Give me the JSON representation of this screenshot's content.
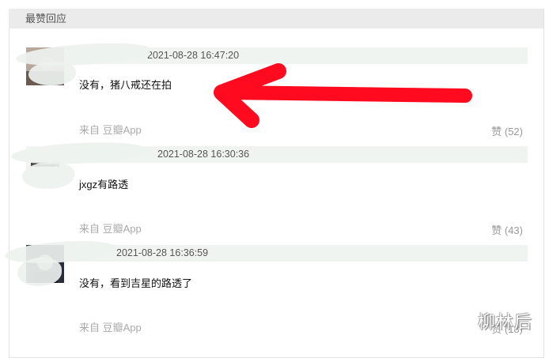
{
  "section": {
    "title": "最赞回应"
  },
  "comments": [
    {
      "time": "2021-08-28 16:47:20",
      "text": "没有，猪八戒还在拍",
      "source": "来自 豆瓣App",
      "likes": "赞 (52)"
    },
    {
      "time": "2021-08-28 16:30:36",
      "text": "jxgz有路透",
      "source": "来自 豆瓣App",
      "likes": "赞 (43)"
    },
    {
      "time": "2021-08-28 16:36:59",
      "text": "没有，看到吉星的路透了",
      "source": "来自 豆瓣App",
      "likes": "赞 (18)"
    }
  ],
  "watermark": {
    "text": "柳林后"
  },
  "colors": {
    "arrow": "#ff0a1e",
    "header_bg": "#ebebeb",
    "meta_bg": "#f0f4f1"
  },
  "icons": {
    "avatar_1": "avatar-image",
    "avatar_2": "avatar-image",
    "avatar_3": "avatar-image",
    "annotation": "red-arrow-left"
  }
}
